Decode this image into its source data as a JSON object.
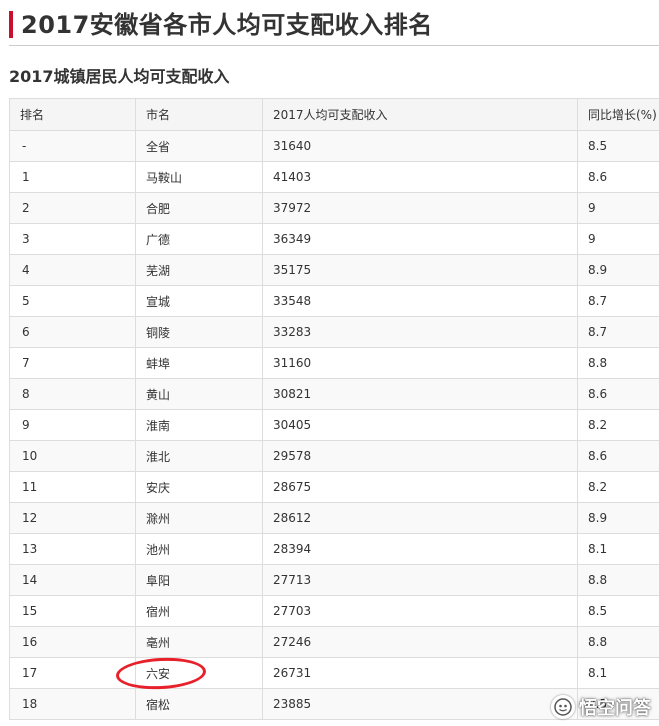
{
  "page": {
    "title": "2017安徽省各市人均可支配收入排名",
    "section_heading": "2017城镇居民人均可支配收入"
  },
  "table": {
    "headers": [
      "排名",
      "市名",
      "2017人均可支配收入",
      "同比增长(%)"
    ],
    "rows": [
      [
        "-",
        "全省",
        "31640",
        "8.5"
      ],
      [
        "1",
        "马鞍山",
        "41403",
        "8.6"
      ],
      [
        "2",
        "合肥",
        "37972",
        "9"
      ],
      [
        "3",
        "广德",
        "36349",
        "9"
      ],
      [
        "4",
        "芜湖",
        "35175",
        "8.9"
      ],
      [
        "5",
        "宣城",
        "33548",
        "8.7"
      ],
      [
        "6",
        "铜陵",
        "33283",
        "8.7"
      ],
      [
        "7",
        "蚌埠",
        "31160",
        "8.8"
      ],
      [
        "8",
        "黄山",
        "30821",
        "8.6"
      ],
      [
        "9",
        "淮南",
        "30405",
        "8.2"
      ],
      [
        "10",
        "淮北",
        "29578",
        "8.6"
      ],
      [
        "11",
        "安庆",
        "28675",
        "8.2"
      ],
      [
        "12",
        "滁州",
        "28612",
        "8.9"
      ],
      [
        "13",
        "池州",
        "28394",
        "8.1"
      ],
      [
        "14",
        "阜阳",
        "27713",
        "8.8"
      ],
      [
        "15",
        "宿州",
        "27703",
        "8.5"
      ],
      [
        "16",
        "亳州",
        "27246",
        "8.8"
      ],
      [
        "17",
        "六安",
        "26731",
        "8.1"
      ],
      [
        "18",
        "宿松",
        "23885",
        "8.5"
      ]
    ]
  },
  "annotation": {
    "highlighted_row": "六安",
    "circle_color": "#e8202a"
  },
  "watermark": {
    "text": "悟空问答",
    "icon": "wukong-logo-icon"
  },
  "colors": {
    "accent": "#c8102e",
    "header_bg": "#f5f5f5",
    "border": "#dddddd"
  }
}
